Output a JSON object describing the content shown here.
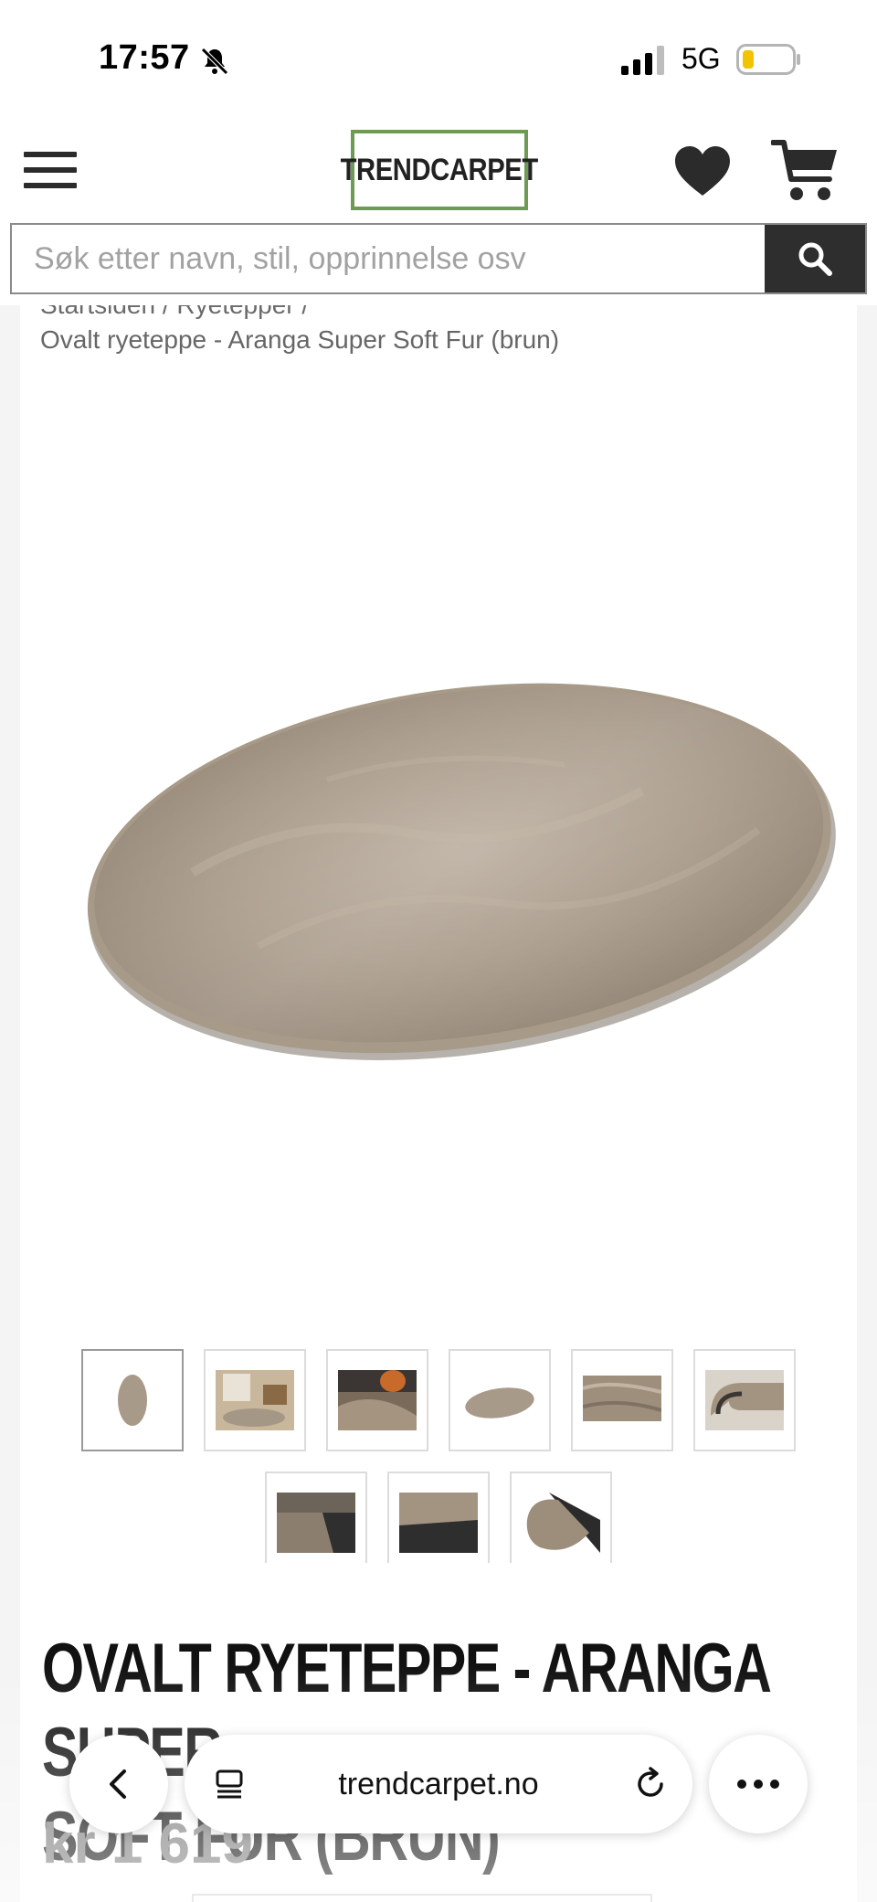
{
  "status_bar": {
    "time": "17:57",
    "network": "5G",
    "icons": [
      "bell-muted-icon",
      "signal-icon",
      "battery-icon"
    ]
  },
  "header": {
    "logo_text": "TRENDCARPET",
    "icons": [
      "menu-icon",
      "heart-icon",
      "cart-icon"
    ],
    "logo_border_color": "#6f9a55"
  },
  "search": {
    "placeholder": "Søk etter navn, stil, opprinnelse osv",
    "button_icon": "search-icon"
  },
  "breadcrumb": {
    "trail": "Startsiden / Ryetepper /",
    "current": "Ovalt ryeteppe - Aranga Super Soft Fur (brun)"
  },
  "product": {
    "title_line1": "OVALT RYETEPPE - ARANGA SUPER",
    "title_line2": "SOFT FUR (BRUN)",
    "price": "kr 1 619",
    "thumbnails": [
      "oval-rug-top",
      "living-room",
      "closeup-floor",
      "oval-rug-angle",
      "texture",
      "rolled-edge",
      "backside",
      "folded-backing",
      "corner-backing"
    ]
  },
  "browser": {
    "url": "trendcarpet.no",
    "icons": [
      "back-icon",
      "reader-icon",
      "reload-icon",
      "more-icon"
    ]
  }
}
